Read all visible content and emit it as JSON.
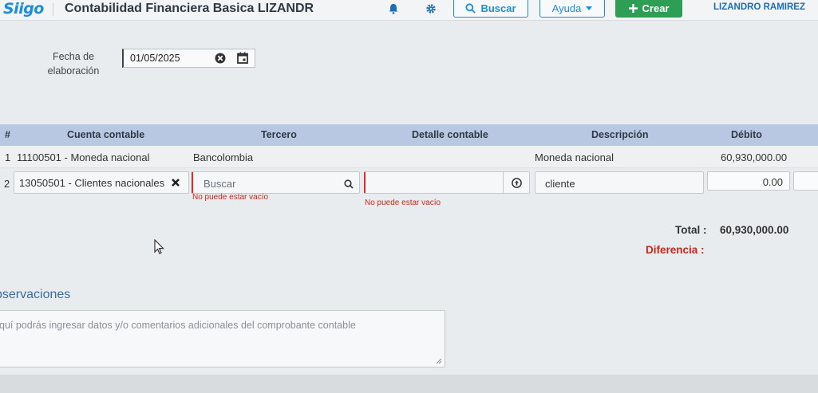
{
  "header": {
    "logo": "Siigo",
    "title": "Contabilidad Financiera Basica LIZANDR",
    "search_label": "Buscar",
    "help_label": "Ayuda",
    "create_label": "Crear",
    "user_name": "LIZANDRO RAMIREZ",
    "accent_color": "#1b8dd9",
    "create_color": "#2f9e55"
  },
  "form": {
    "date_label": "Fecha de elaboración",
    "date_value": "01/05/2025"
  },
  "table": {
    "columns": [
      "#",
      "Cuenta contable",
      "Tercero",
      "Detalle contable",
      "Descripción",
      "Débito"
    ],
    "rows": [
      {
        "num": "1",
        "account": "11100501 - Moneda nacional",
        "third_party": "Bancolombia",
        "detail": "",
        "description": "Moneda nacional",
        "debit": "60,930,000.00"
      },
      {
        "num": "2",
        "account": "13050501 - Clientes nacionales",
        "third_party_placeholder": "Buscar",
        "third_party_error": "No puede estar vacío",
        "detail_value": "",
        "detail_error": "No puede estar vacío",
        "description": "cliente",
        "debit": "0.00"
      }
    ]
  },
  "totals": {
    "total_label": "Total :",
    "total_value": "60,930,000.00",
    "difference_label": "Diferencia :"
  },
  "observations": {
    "title": "Observaciones",
    "title_visible": "bservaciones",
    "placeholder": "quí podrás ingresar datos y/o comentarios adicionales del comprobante contable"
  },
  "icons": {
    "bell": "bell-icon",
    "settings": "gear-icon",
    "search": "search-icon",
    "clear": "clear-icon",
    "calendar": "calendar-icon",
    "remove": "close-icon",
    "add": "add-icon",
    "chevron": "chevron-down-icon"
  }
}
